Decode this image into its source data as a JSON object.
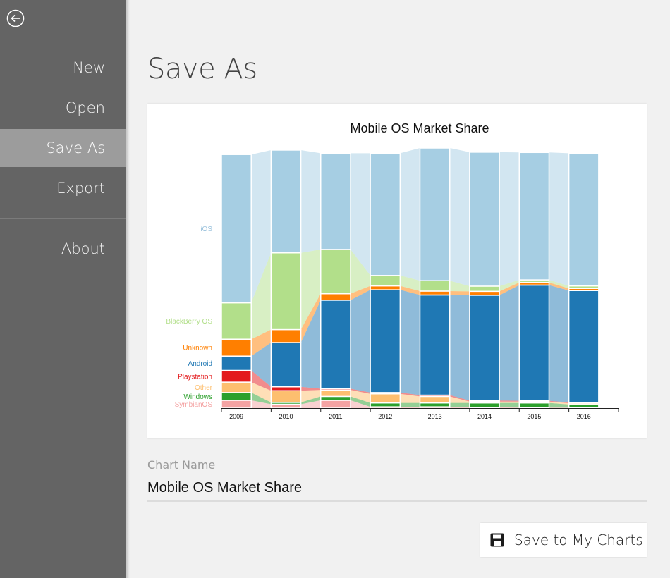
{
  "sidebar": {
    "back_icon": "back-arrow-circle-icon",
    "items": [
      {
        "label": "New",
        "active": false
      },
      {
        "label": "Open",
        "active": false
      },
      {
        "label": "Save As",
        "active": true
      },
      {
        "label": "Export",
        "active": false
      },
      {
        "label": "About",
        "active": false
      }
    ]
  },
  "page": {
    "title": "Save As"
  },
  "form": {
    "name_label": "Chart Name",
    "name_value": "Mobile OS Market Share",
    "save_button_label": "Save to My Charts",
    "save_icon": "floppy-disk-icon"
  },
  "chart_data": {
    "type": "marimekko",
    "title": "Mobile OS Market Share",
    "categories": [
      "2009",
      "2010",
      "2011",
      "2012",
      "2013",
      "2014",
      "2015",
      "2016"
    ],
    "ylim": [
      0,
      100
    ],
    "series": [
      {
        "name": "SymbianOS",
        "color": "#f4a3a3",
        "values": [
          3.0,
          1.5,
          3.0,
          0.5,
          0.5,
          0.3,
          0.2,
          0.2
        ]
      },
      {
        "name": "Windows",
        "color": "#2ca02c",
        "values": [
          3.0,
          0.7,
          1.5,
          1.5,
          1.5,
          1.7,
          1.8,
          1.2
        ]
      },
      {
        "name": "Other",
        "color": "#fdbf6f",
        "values": [
          4.0,
          4.5,
          2.5,
          3.5,
          2.5,
          0.5,
          0.5,
          0.5
        ]
      },
      {
        "name": "Playstation",
        "color": "#e31a1c",
        "values": [
          4.5,
          1.5,
          0.5,
          0.5,
          0.5,
          0.4,
          0.3,
          0.3
        ]
      },
      {
        "name": "Android",
        "color": "#1f78b4",
        "values": [
          5.5,
          17.0,
          34.0,
          39.5,
          38.5,
          40.5,
          44.5,
          43.0
        ]
      },
      {
        "name": "Unknown",
        "color": "#ff7f00",
        "values": [
          6.5,
          5.0,
          2.5,
          1.5,
          1.5,
          1.5,
          1.0,
          0.8
        ]
      },
      {
        "name": "BlackBerry OS",
        "color": "#b2df8a",
        "values": [
          14.0,
          29.5,
          17.0,
          4.0,
          4.0,
          2.0,
          1.0,
          1.0
        ]
      },
      {
        "name": "iOS",
        "color": "#a6cee3",
        "values": [
          57.0,
          39.5,
          37.0,
          47.0,
          51.0,
          51.5,
          49.0,
          51.0
        ]
      }
    ]
  }
}
